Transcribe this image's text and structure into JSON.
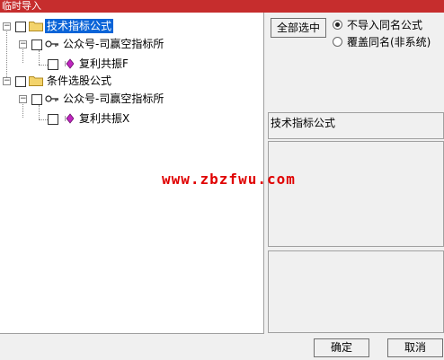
{
  "window": {
    "title": "临时导入"
  },
  "tree": {
    "root1": {
      "label": "技术指标公式"
    },
    "child1": {
      "label": "公众号-司赢空指标所"
    },
    "leaf1": {
      "label": "复利共振F"
    },
    "root2": {
      "label": "条件选股公式"
    },
    "child2": {
      "label": "公众号-司赢空指标所"
    },
    "leaf2": {
      "label": "复利共振X"
    }
  },
  "options": {
    "select_all": "全部选中",
    "radio1": "不导入同名公式",
    "radio2": "覆盖同名(非系统)",
    "radio_selected": "radio1"
  },
  "info": {
    "type_label": "技术指标公式"
  },
  "watermark": "www.zbzfwu.com",
  "footer": {
    "ok": "确定",
    "cancel": "取消"
  }
}
